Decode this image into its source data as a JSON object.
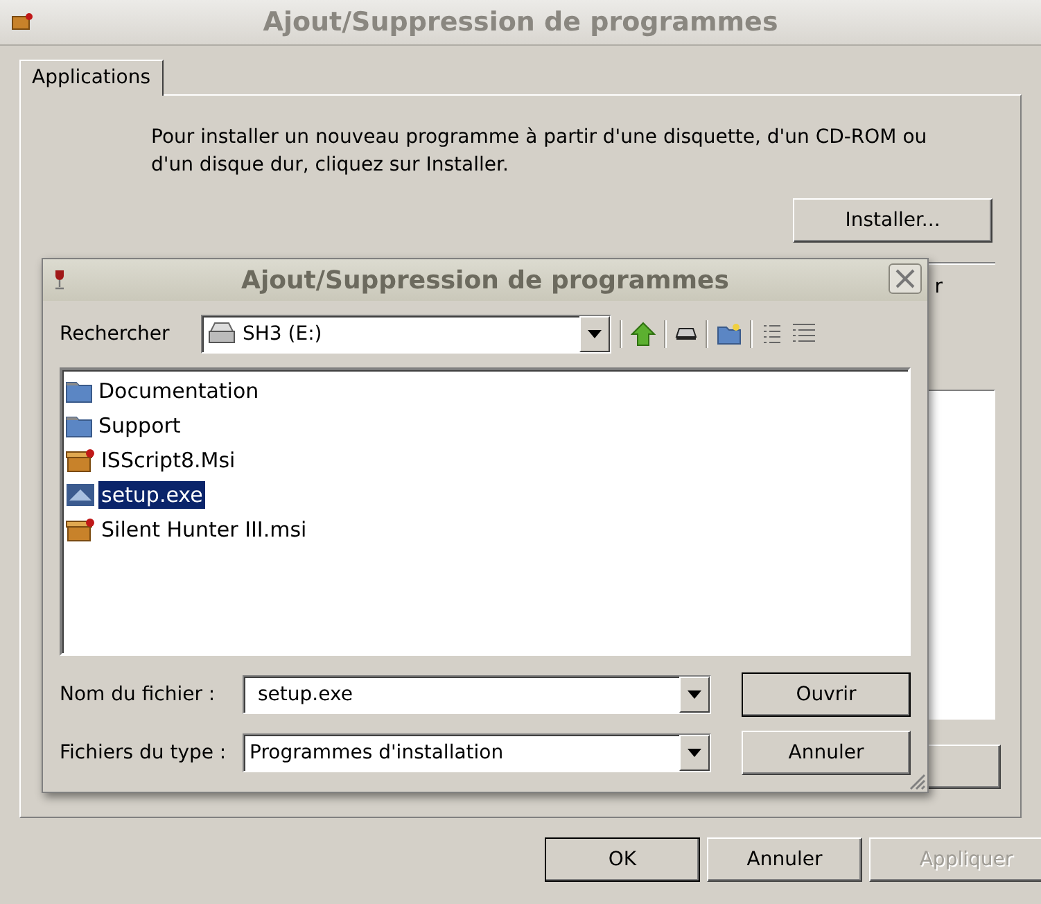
{
  "window": {
    "title": "Ajout/Suppression de programmes"
  },
  "tabs": [
    {
      "label": "Applications",
      "selected": true
    }
  ],
  "install_text": "Pour installer un nouveau programme à partir d'une disquette, d'un CD-ROM ou d'un disque dur, cliquez sur Installer.",
  "install_button": "Installer...",
  "hidden_text_fragment": "r",
  "buttons": [
    {
      "label": "OK",
      "default": true,
      "disabled": false
    },
    {
      "label": "Annuler",
      "default": false,
      "disabled": false
    },
    {
      "label": "Appliquer",
      "default": false,
      "disabled": true
    }
  ],
  "dialog": {
    "title": "Ajout/Suppression de programmes",
    "look_in_label": "Rechercher",
    "look_in_value": "SH3 (E:)",
    "files": [
      {
        "name": "Documentation",
        "kind": "folder",
        "selected": false
      },
      {
        "name": "Support",
        "kind": "folder",
        "selected": false
      },
      {
        "name": "ISScript8.Msi",
        "kind": "package",
        "selected": false
      },
      {
        "name": "setup.exe",
        "kind": "program",
        "selected": true
      },
      {
        "name": "Silent Hunter III.msi",
        "kind": "package",
        "selected": false
      }
    ],
    "filename_label": "Nom du fichier :",
    "filename_value": "setup.exe",
    "filetype_label": "Fichiers du type :",
    "filetype_value": "Programmes d'installation",
    "open_button": "Ouvrir",
    "cancel_button": "Annuler"
  }
}
